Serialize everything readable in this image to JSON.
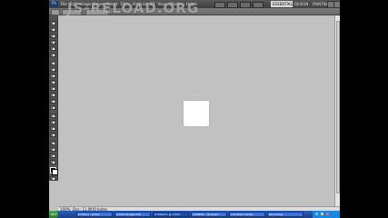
{
  "watermark": "JS-RELOAD.ORG",
  "menus": [
    "File",
    "Edit",
    "Image",
    "Layer",
    "Select",
    "Filter",
    "Analysis",
    "3D",
    "View",
    "Window",
    "Help"
  ],
  "workspace_switcher": {
    "essentials": "ESSENTIALS",
    "design": "DESIGN",
    "painting": "PAINTING"
  },
  "status": {
    "zoom": "100%",
    "info": "Doc: 11,0K/0 bytes"
  },
  "taskbar": {
    "start": "start",
    "buttons": [
      "Untitled - Notes",
      "Adobe Bridge CS5",
      "Untitled-1 @ 100%",
      "CAMERA - Notepad",
      "Camtasia Studio",
      "Recording"
    ]
  },
  "colors": {
    "workspace_bg": "#c1c1c1",
    "toolbar_bg": "#535353",
    "taskbar_bg": "#2a5fb8",
    "document_bg": "#ffffff"
  }
}
